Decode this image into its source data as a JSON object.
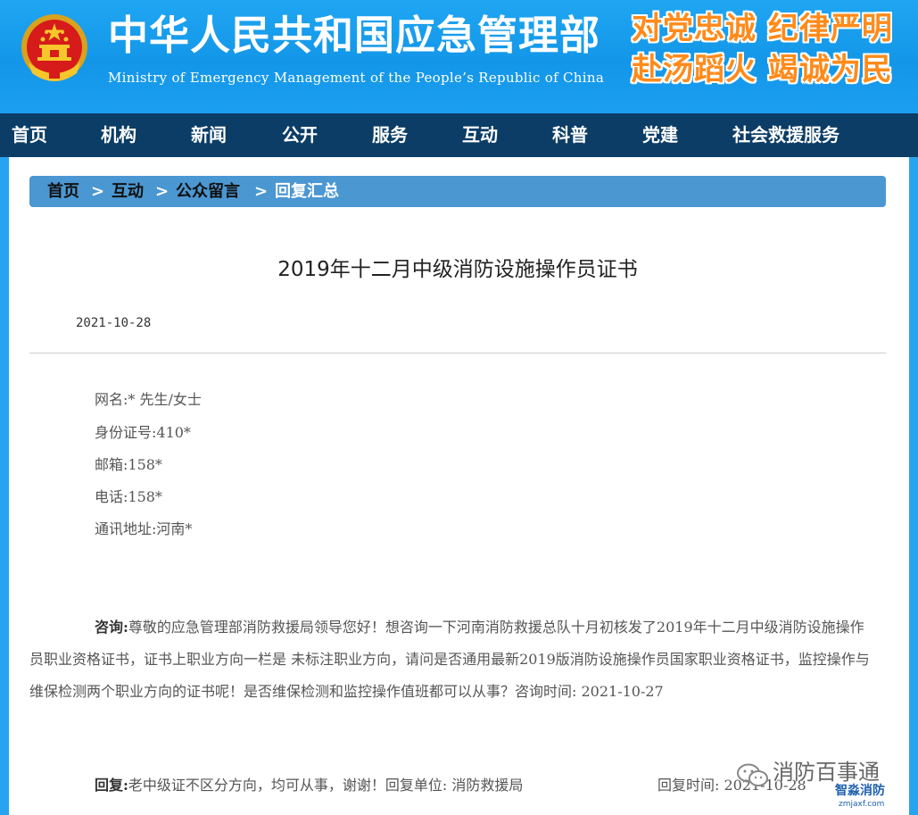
{
  "header": {
    "title_cn": "中华人民共和国应急管理部",
    "title_en": "Ministry of Emergency Management of the People’s Republic of China",
    "slogan_line1": "对党忠诚 纪律严明",
    "slogan_line2": "赴汤蹈火 竭诚为民",
    "emblem_icon": "national-emblem-icon",
    "bg_color": "#1b9ef0",
    "slogan_color": "#ff8a1a"
  },
  "nav": {
    "bg_color": "#0b3d66",
    "items": [
      {
        "label": "首页"
      },
      {
        "label": "机构"
      },
      {
        "label": "新闻"
      },
      {
        "label": "公开"
      },
      {
        "label": "服务"
      },
      {
        "label": "互动"
      },
      {
        "label": "科普"
      },
      {
        "label": "党建"
      },
      {
        "label": "社会救援服务"
      }
    ]
  },
  "breadcrumb": {
    "bg_color": "#4b97d2",
    "separator": ">",
    "items": [
      {
        "label": "首页"
      },
      {
        "label": "互动"
      },
      {
        "label": "公众留言"
      },
      {
        "label": "回复汇总"
      }
    ]
  },
  "article": {
    "title": "2019年十二月中级消防设施操作员证书",
    "date": "2021-10-28",
    "info": [
      "网名:* 先生/女士",
      "身份证号:410*",
      "邮箱:158*",
      "电话:158*",
      "通讯地址:河南*"
    ],
    "question_label": "咨询:",
    "question_text": "尊敬的应急管理部消防救援局领导您好！想咨询一下河南消防救援总队十月初核发了2019年十二月中级消防设施操作员职业资格证书，证书上职业方向一栏是 未标注职业方向，请问是否通用最新2019版消防设施操作员国家职业资格证书，监控操作与维保检测两个职业方向的证书呢！是否维保检测和监控操作值班都可以从事？咨询时间: 2021-10-27",
    "reply_label": "回复:",
    "reply_text": "老中级证不区分方向，均可从事，谢谢！回复单位: 消防救援局",
    "reply_time": "回复时间: 2021-10-28"
  },
  "watermark": {
    "channel": "消防百事通",
    "logo_text": "智淼消防",
    "site": "zmjaxf.com",
    "wechat_icon": "wechat-icon"
  }
}
